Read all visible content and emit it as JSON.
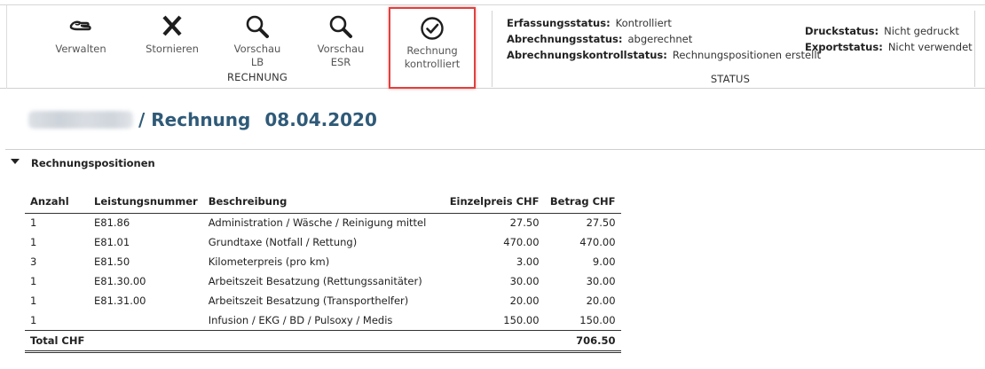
{
  "ribbon": {
    "buttons": {
      "verwalten": {
        "label": "Verwalten",
        "icon": "manage-hand-icon"
      },
      "stornieren": {
        "label": "Stornieren",
        "icon": "close-icon"
      },
      "vorschau_lb": {
        "label_line1": "Vorschau",
        "label_line2": "LB",
        "icon": "search-icon"
      },
      "vorschau_esr": {
        "label_line1": "Vorschau",
        "label_line2": "ESR",
        "icon": "search-icon"
      },
      "kontrolliert": {
        "label_line1": "Rechnung",
        "label_line2": "kontrolliert",
        "icon": "check-circle-icon",
        "highlight_color": "#e0403e"
      }
    },
    "group_rechnung": "RECHNUNG",
    "group_status": "STATUS",
    "status": {
      "erfassung": {
        "label": "Erfassungsstatus:",
        "value": "Kontrolliert"
      },
      "abrechnung": {
        "label": "Abrechnungsstatus:",
        "value": "abgerechnet"
      },
      "abrechnungskontroll": {
        "label": "Abrechnungskontrollstatus:",
        "value": "Rechnungspositionen erstellt"
      },
      "druck": {
        "label": "Druckstatus:",
        "value": "Nicht gedruckt"
      },
      "export": {
        "label": "Exportstatus:",
        "value": "Nicht verwendet"
      }
    }
  },
  "page": {
    "title_suffix": "/ Rechnung",
    "date": "08.04.2020",
    "title_color": "#2f5a78"
  },
  "section": {
    "title": "Rechnungspositionen"
  },
  "table": {
    "headers": {
      "anzahl": "Anzahl",
      "leistungsnummer": "Leistungsnummer",
      "beschreibung": "Beschreibung",
      "einzelpreis": "Einzelpreis CHF",
      "betrag": "Betrag CHF"
    },
    "rows": [
      {
        "anzahl": "1",
        "nummer": "E81.86",
        "beschreibung": "Administration / Wäsche / Reinigung mittel",
        "einzelpreis": "27.50",
        "betrag": "27.50"
      },
      {
        "anzahl": "1",
        "nummer": "E81.01",
        "beschreibung": "Grundtaxe (Notfall / Rettung)",
        "einzelpreis": "470.00",
        "betrag": "470.00"
      },
      {
        "anzahl": "3",
        "nummer": "E81.50",
        "beschreibung": "Kilometerpreis (pro km)",
        "einzelpreis": "3.00",
        "betrag": "9.00"
      },
      {
        "anzahl": "1",
        "nummer": "E81.30.00",
        "beschreibung": "Arbeitszeit Besatzung (Rettungssanitäter)",
        "einzelpreis": "30.00",
        "betrag": "30.00"
      },
      {
        "anzahl": "1",
        "nummer": "E81.31.00",
        "beschreibung": "Arbeitszeit Besatzung (Transporthelfer)",
        "einzelpreis": "20.00",
        "betrag": "20.00"
      },
      {
        "anzahl": "1",
        "nummer": "",
        "beschreibung": "Infusion / EKG / BD / Pulsoxy / Medis",
        "einzelpreis": "150.00",
        "betrag": "150.00"
      }
    ],
    "total_label": "Total CHF",
    "total_value": "706.50"
  }
}
